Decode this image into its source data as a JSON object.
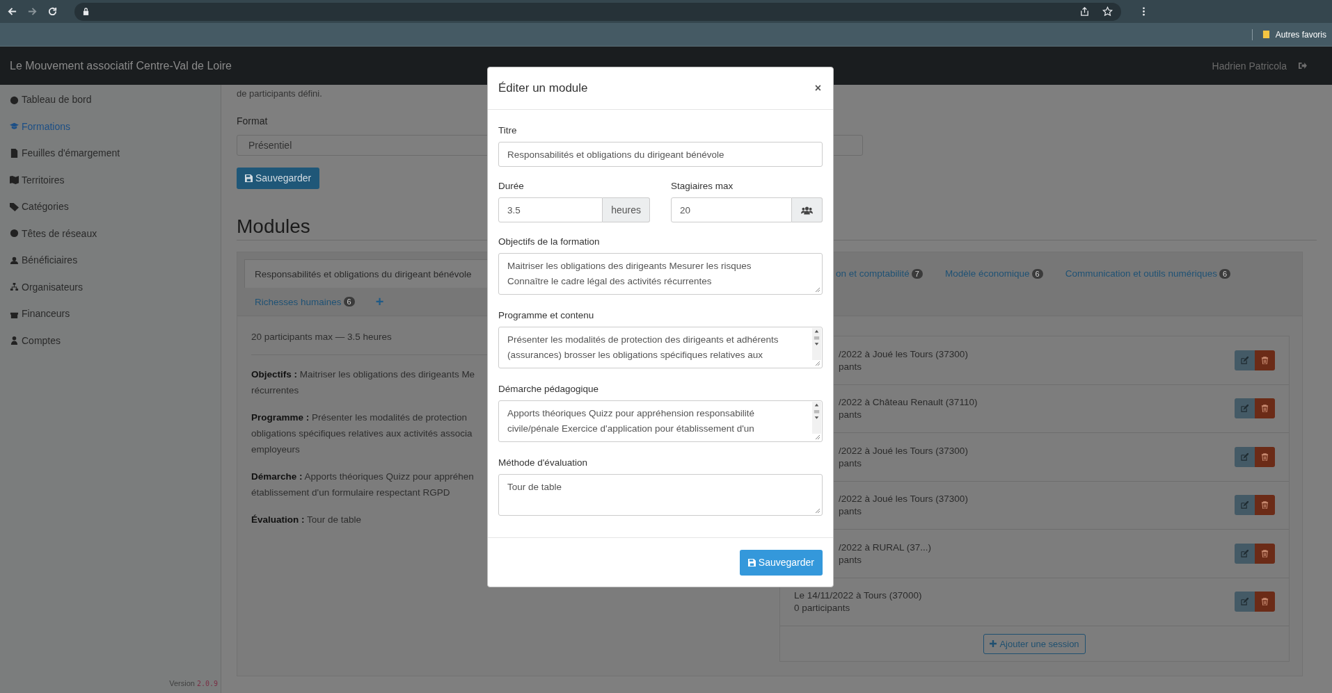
{
  "browser": {
    "bookmarks": [
      {
        "label": "Autres favoris"
      }
    ]
  },
  "header": {
    "brand": "Le Mouvement associatif Centre-Val de Loire",
    "user": "Hadrien Patricola"
  },
  "sidebar": {
    "items": [
      {
        "label": "Tableau de bord",
        "selected": false
      },
      {
        "label": "Formations",
        "selected": true
      },
      {
        "label": "Feuilles d'émargement",
        "selected": false
      },
      {
        "label": "Territoires",
        "selected": false
      },
      {
        "label": "Catégories",
        "selected": false
      },
      {
        "label": "Têtes de réseaux",
        "selected": false
      },
      {
        "label": "Bénéficiaires",
        "selected": false
      },
      {
        "label": "Organisateurs",
        "selected": false
      },
      {
        "label": "Financeurs",
        "selected": false
      },
      {
        "label": "Comptes",
        "selected": false
      }
    ],
    "version_label": "Version",
    "version": "2.0.9"
  },
  "form": {
    "intro": "de participants défini.",
    "format_label": "Format",
    "format_value": "Présentiel",
    "save": "Sauvegarder"
  },
  "modules": {
    "heading": "Modules",
    "tabs": [
      {
        "label": "Responsabilités et obligations du dirigeant bénévole",
        "selected": true
      },
      {
        "label": "on et comptabilité",
        "count": "7",
        "selected": false
      },
      {
        "label": "Modèle économique",
        "count": "6",
        "selected": false
      },
      {
        "label": "Communication et outils numériques",
        "count": "6",
        "selected": false
      },
      {
        "label": "Richesses humaines",
        "count": "6",
        "selected": false
      }
    ],
    "add_tab": "+",
    "summary": "20 participants max — 3.5 heures",
    "details": [
      {
        "lines": [
          "**Objectifs :** Maitriser les obligations des dirigeants Me",
          "récurrentes"
        ]
      },
      {
        "lines": [
          "**Programme :** Présenter les modalités de protection",
          "obligations spécifiques relatives aux activités associa",
          "employeurs"
        ]
      },
      {
        "lines": [
          "**Démarche :** Apports théoriques Quizz pour appréhen",
          "établissement d'un formulaire respectant RGPD"
        ]
      },
      {
        "lines": [
          "**Évaluation :** Tour de table"
        ]
      }
    ],
    "sessions": [
      {
        "kind": "partial",
        "title": "/2022 à Joué les Tours (37300)",
        "subtitle": "pants"
      },
      {
        "kind": "partial",
        "title": "/2022 à Château Renault (37110)",
        "subtitle": "pants"
      },
      {
        "kind": "partial",
        "title": "/2022 à Joué les Tours (37300)",
        "subtitle": "pants"
      },
      {
        "kind": "partial",
        "title": "/2022 à Joué les Tours (37300)",
        "subtitle": "pants"
      },
      {
        "kind": "partial",
        "title": "/2022 à RURAL (37...)",
        "subtitle": "pants"
      },
      {
        "kind": "full",
        "title": "Le 14/11/2022 à Tours (37000)",
        "subtitle": "0 participants"
      }
    ],
    "add_session": "Ajouter une session"
  },
  "modal": {
    "title": "Éditer un module",
    "close": "×",
    "titre": {
      "label": "Titre",
      "value": "Responsabilités et obligations du dirigeant bénévole"
    },
    "duree": {
      "label": "Durée",
      "value": "3.5",
      "unit": "heures"
    },
    "stagiaires": {
      "label": "Stagiaires max",
      "value": "20"
    },
    "textareas": [
      {
        "label": "Objectifs de la formation",
        "value": "Maitriser les obligations des dirigeants Mesurer les risques\nConnaître le cadre légal des activités récurrentes",
        "scrollable": false
      },
      {
        "label": "Programme et contenu",
        "value": "Présenter les modalités de protection des dirigeants et adhérents\n(assurances) brosser les obligations spécifiques relatives aux",
        "scrollable": true
      },
      {
        "label": "Démarche pédagogique",
        "value": "Apports théoriques Quizz pour appréhension responsabilité\ncivile/pénale Exercice d'application pour établissement d'un",
        "scrollable": true
      },
      {
        "label": "Méthode d'évaluation",
        "value": "Tour de table",
        "scrollable": false
      }
    ],
    "save": "Sauvegarder"
  }
}
